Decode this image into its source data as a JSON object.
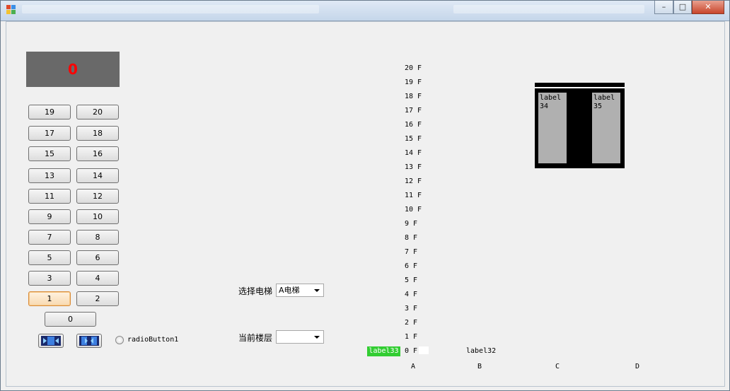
{
  "display": {
    "value": "0"
  },
  "floor_buttons": [
    {
      "label": "19"
    },
    {
      "label": "20"
    },
    {
      "label": "17"
    },
    {
      "label": "18"
    },
    {
      "label": "15"
    },
    {
      "label": "16"
    },
    {
      "label": "13"
    },
    {
      "label": "14"
    },
    {
      "label": "11"
    },
    {
      "label": "12"
    },
    {
      "label": "9"
    },
    {
      "label": "10"
    },
    {
      "label": "7"
    },
    {
      "label": "8"
    },
    {
      "label": "5"
    },
    {
      "label": "6"
    },
    {
      "label": "3"
    },
    {
      "label": "4"
    },
    {
      "label": "1"
    },
    {
      "label": "2"
    },
    {
      "label": "0"
    }
  ],
  "radio": {
    "label": "radioButton1"
  },
  "select_elevator": {
    "label": "选择电梯",
    "value": "A电梯"
  },
  "current_floor": {
    "label": "当前楼层",
    "value": ""
  },
  "floors": [
    "20 F",
    "19 F",
    "18 F",
    "17 F",
    "16 F",
    "15 F",
    "14 F",
    "13 F",
    "12 F",
    "11 F",
    "10 F",
    "9 F",
    "8 F",
    "7 F",
    "6 F",
    "5 F",
    "4 F",
    "3 F",
    "2 F",
    "1 F",
    "0 F"
  ],
  "labels": {
    "label33": "label33",
    "label32": "label32",
    "label34": "label\n34",
    "label35": "label\n35"
  },
  "columns": [
    "A",
    "B",
    "C",
    "D"
  ],
  "colors": {
    "display_bg": "#696969",
    "display_text": "#ff0000",
    "highlight": "#32cd32",
    "shaft": "#000000",
    "door": "#b0b0b0"
  }
}
